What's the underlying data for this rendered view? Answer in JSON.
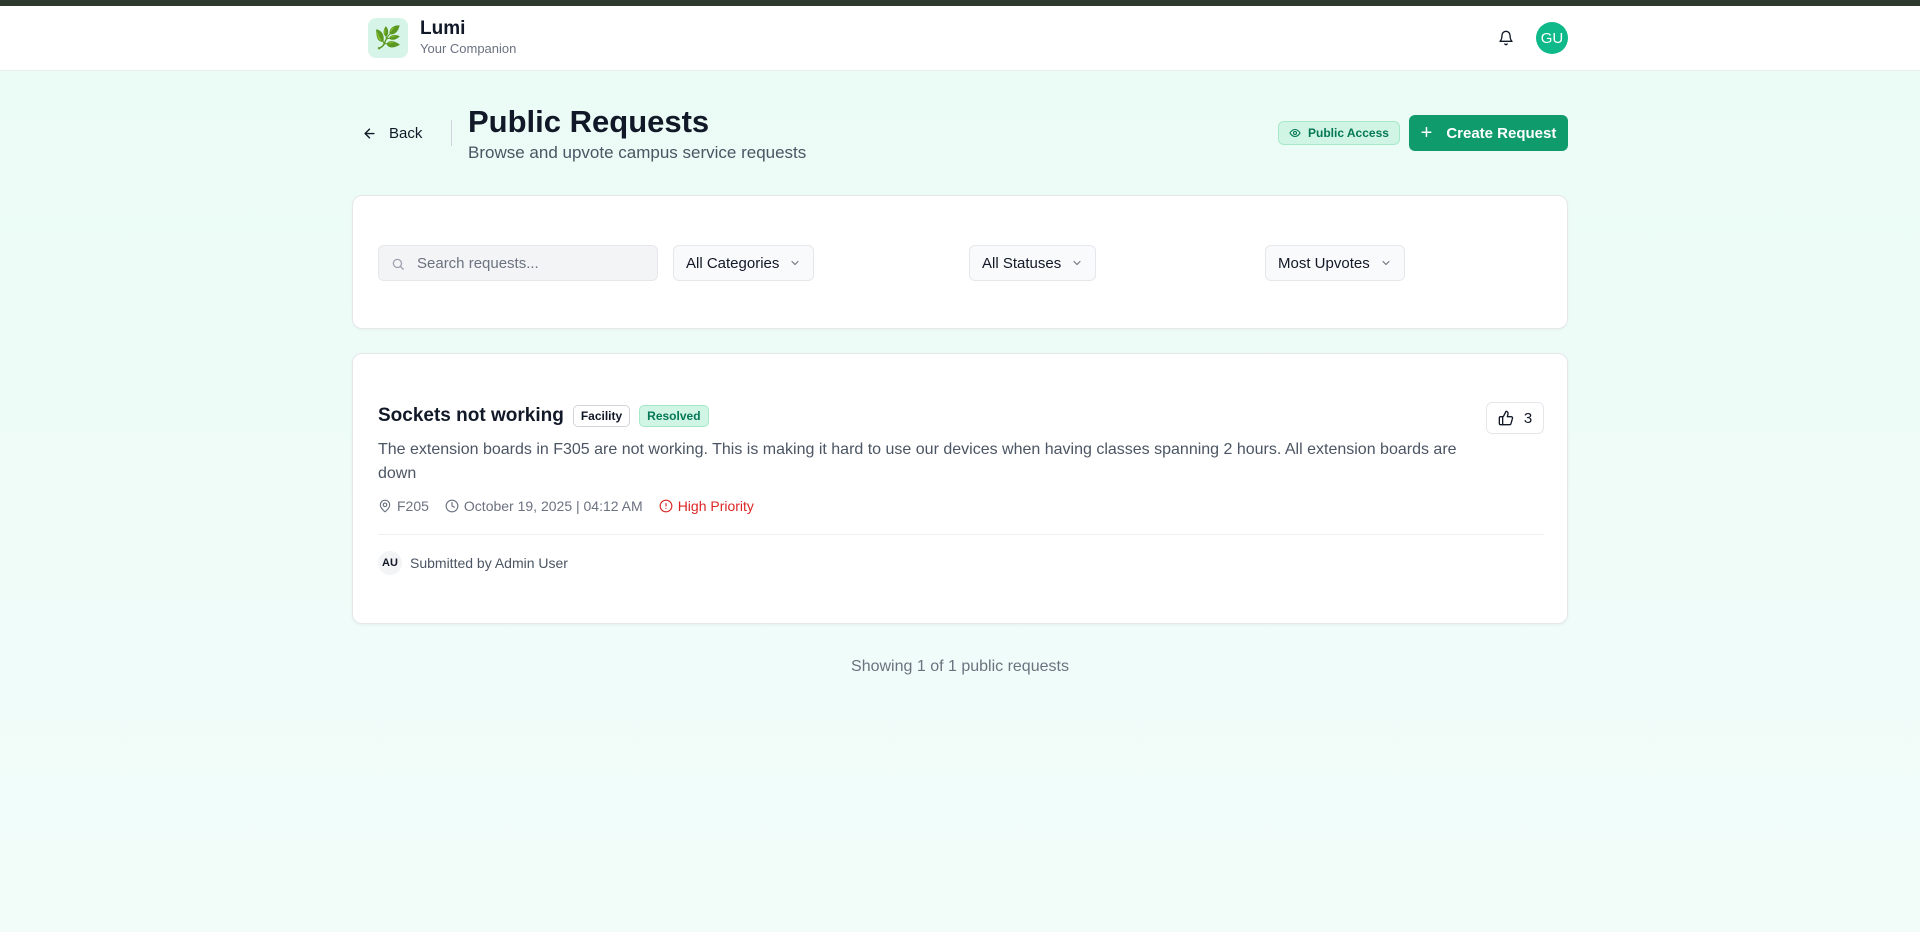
{
  "colors": {
    "accent": "#0f9b6c",
    "avatar": "#10b98a",
    "resolved_bg": "#d1f5e4",
    "priority_high": "#dc2626"
  },
  "header": {
    "brand_name": "Lumi",
    "brand_tagline": "Your Companion",
    "logo_icon": "leaf-icon",
    "user_initials": "GU"
  },
  "page": {
    "back_label": "Back",
    "title": "Public Requests",
    "subtitle": "Browse and upvote campus service requests",
    "public_badge": "Public Access",
    "create_button": "Create Request"
  },
  "filters": {
    "search_placeholder": "Search requests...",
    "search_value": "",
    "category": "All Categories",
    "status": "All Statuses",
    "sort": "Most Upvotes"
  },
  "requests": [
    {
      "title": "Sockets not working",
      "category": "Facility",
      "status": "Resolved",
      "description": "The extension boards in F305 are not working. This is making it hard to use our devices when having classes spanning 2 hours. All extension boards are down",
      "location": "F205",
      "datetime": "October 19, 2025 | 04:12 AM",
      "priority": "High Priority",
      "upvotes": "3",
      "submitter_initials": "AU",
      "submitted_by": "Submitted by Admin User"
    }
  ],
  "footer": {
    "showing_text": "Showing 1 of 1 public requests"
  }
}
